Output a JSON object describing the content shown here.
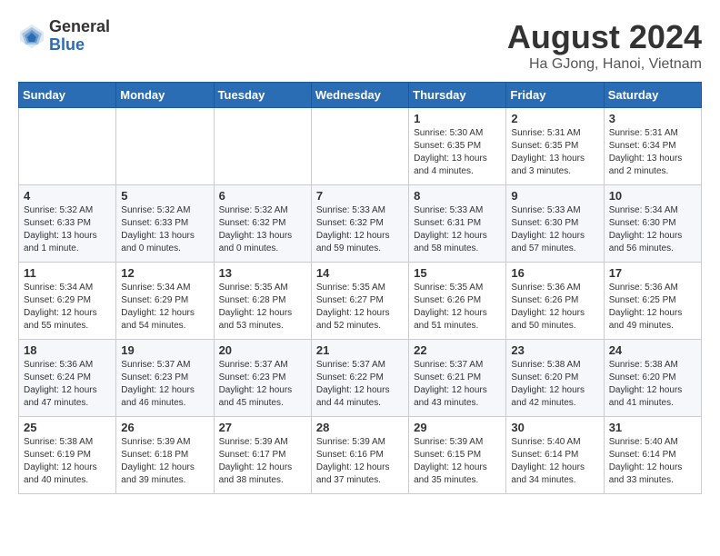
{
  "header": {
    "logo_general": "General",
    "logo_blue": "Blue",
    "month_title": "August 2024",
    "location": "Ha GJong, Hanoi, Vietnam"
  },
  "weekdays": [
    "Sunday",
    "Monday",
    "Tuesday",
    "Wednesday",
    "Thursday",
    "Friday",
    "Saturday"
  ],
  "weeks": [
    [
      {
        "day": "",
        "info": ""
      },
      {
        "day": "",
        "info": ""
      },
      {
        "day": "",
        "info": ""
      },
      {
        "day": "",
        "info": ""
      },
      {
        "day": "1",
        "info": "Sunrise: 5:30 AM\nSunset: 6:35 PM\nDaylight: 13 hours\nand 4 minutes."
      },
      {
        "day": "2",
        "info": "Sunrise: 5:31 AM\nSunset: 6:35 PM\nDaylight: 13 hours\nand 3 minutes."
      },
      {
        "day": "3",
        "info": "Sunrise: 5:31 AM\nSunset: 6:34 PM\nDaylight: 13 hours\nand 2 minutes."
      }
    ],
    [
      {
        "day": "4",
        "info": "Sunrise: 5:32 AM\nSunset: 6:33 PM\nDaylight: 13 hours\nand 1 minute."
      },
      {
        "day": "5",
        "info": "Sunrise: 5:32 AM\nSunset: 6:33 PM\nDaylight: 13 hours\nand 0 minutes."
      },
      {
        "day": "6",
        "info": "Sunrise: 5:32 AM\nSunset: 6:32 PM\nDaylight: 13 hours\nand 0 minutes."
      },
      {
        "day": "7",
        "info": "Sunrise: 5:33 AM\nSunset: 6:32 PM\nDaylight: 12 hours\nand 59 minutes."
      },
      {
        "day": "8",
        "info": "Sunrise: 5:33 AM\nSunset: 6:31 PM\nDaylight: 12 hours\nand 58 minutes."
      },
      {
        "day": "9",
        "info": "Sunrise: 5:33 AM\nSunset: 6:30 PM\nDaylight: 12 hours\nand 57 minutes."
      },
      {
        "day": "10",
        "info": "Sunrise: 5:34 AM\nSunset: 6:30 PM\nDaylight: 12 hours\nand 56 minutes."
      }
    ],
    [
      {
        "day": "11",
        "info": "Sunrise: 5:34 AM\nSunset: 6:29 PM\nDaylight: 12 hours\nand 55 minutes."
      },
      {
        "day": "12",
        "info": "Sunrise: 5:34 AM\nSunset: 6:29 PM\nDaylight: 12 hours\nand 54 minutes."
      },
      {
        "day": "13",
        "info": "Sunrise: 5:35 AM\nSunset: 6:28 PM\nDaylight: 12 hours\nand 53 minutes."
      },
      {
        "day": "14",
        "info": "Sunrise: 5:35 AM\nSunset: 6:27 PM\nDaylight: 12 hours\nand 52 minutes."
      },
      {
        "day": "15",
        "info": "Sunrise: 5:35 AM\nSunset: 6:26 PM\nDaylight: 12 hours\nand 51 minutes."
      },
      {
        "day": "16",
        "info": "Sunrise: 5:36 AM\nSunset: 6:26 PM\nDaylight: 12 hours\nand 50 minutes."
      },
      {
        "day": "17",
        "info": "Sunrise: 5:36 AM\nSunset: 6:25 PM\nDaylight: 12 hours\nand 49 minutes."
      }
    ],
    [
      {
        "day": "18",
        "info": "Sunrise: 5:36 AM\nSunset: 6:24 PM\nDaylight: 12 hours\nand 47 minutes."
      },
      {
        "day": "19",
        "info": "Sunrise: 5:37 AM\nSunset: 6:23 PM\nDaylight: 12 hours\nand 46 minutes."
      },
      {
        "day": "20",
        "info": "Sunrise: 5:37 AM\nSunset: 6:23 PM\nDaylight: 12 hours\nand 45 minutes."
      },
      {
        "day": "21",
        "info": "Sunrise: 5:37 AM\nSunset: 6:22 PM\nDaylight: 12 hours\nand 44 minutes."
      },
      {
        "day": "22",
        "info": "Sunrise: 5:37 AM\nSunset: 6:21 PM\nDaylight: 12 hours\nand 43 minutes."
      },
      {
        "day": "23",
        "info": "Sunrise: 5:38 AM\nSunset: 6:20 PM\nDaylight: 12 hours\nand 42 minutes."
      },
      {
        "day": "24",
        "info": "Sunrise: 5:38 AM\nSunset: 6:20 PM\nDaylight: 12 hours\nand 41 minutes."
      }
    ],
    [
      {
        "day": "25",
        "info": "Sunrise: 5:38 AM\nSunset: 6:19 PM\nDaylight: 12 hours\nand 40 minutes."
      },
      {
        "day": "26",
        "info": "Sunrise: 5:39 AM\nSunset: 6:18 PM\nDaylight: 12 hours\nand 39 minutes."
      },
      {
        "day": "27",
        "info": "Sunrise: 5:39 AM\nSunset: 6:17 PM\nDaylight: 12 hours\nand 38 minutes."
      },
      {
        "day": "28",
        "info": "Sunrise: 5:39 AM\nSunset: 6:16 PM\nDaylight: 12 hours\nand 37 minutes."
      },
      {
        "day": "29",
        "info": "Sunrise: 5:39 AM\nSunset: 6:15 PM\nDaylight: 12 hours\nand 35 minutes."
      },
      {
        "day": "30",
        "info": "Sunrise: 5:40 AM\nSunset: 6:14 PM\nDaylight: 12 hours\nand 34 minutes."
      },
      {
        "day": "31",
        "info": "Sunrise: 5:40 AM\nSunset: 6:14 PM\nDaylight: 12 hours\nand 33 minutes."
      }
    ]
  ]
}
